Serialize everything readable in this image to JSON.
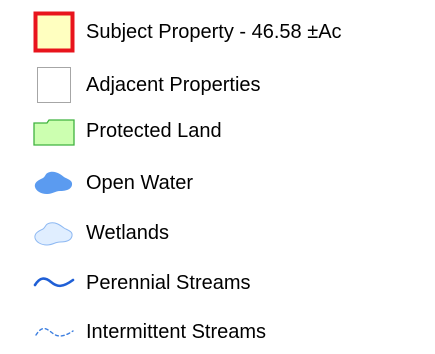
{
  "legend": {
    "items": [
      {
        "label": "Subject Property -  46.58 ±Ac",
        "icon": "subject-property-swatch",
        "fill": "#FFFFC0",
        "stroke": "#E8141C"
      },
      {
        "label": "Adjacent Properties",
        "icon": "adjacent-properties-swatch",
        "fill": "#FFFFFF",
        "stroke": "#A6A6A6"
      },
      {
        "label": "Protected Land",
        "icon": "protected-land-swatch",
        "fill": "#CCFFB0",
        "stroke": "#3FB23F"
      },
      {
        "label": "Open Water",
        "icon": "open-water-swatch",
        "fill": "#5B9BF0"
      },
      {
        "label": "Wetlands",
        "icon": "wetlands-swatch",
        "fill": "#E0EEFF",
        "stroke": "#8DB8F2"
      },
      {
        "label": "Perennial Streams",
        "icon": "perennial-stream-line",
        "stroke": "#1F5FD6"
      },
      {
        "label": "Intermittent Streams",
        "icon": "intermittent-stream-dashed-line",
        "stroke": "#3D7FE0"
      }
    ]
  }
}
